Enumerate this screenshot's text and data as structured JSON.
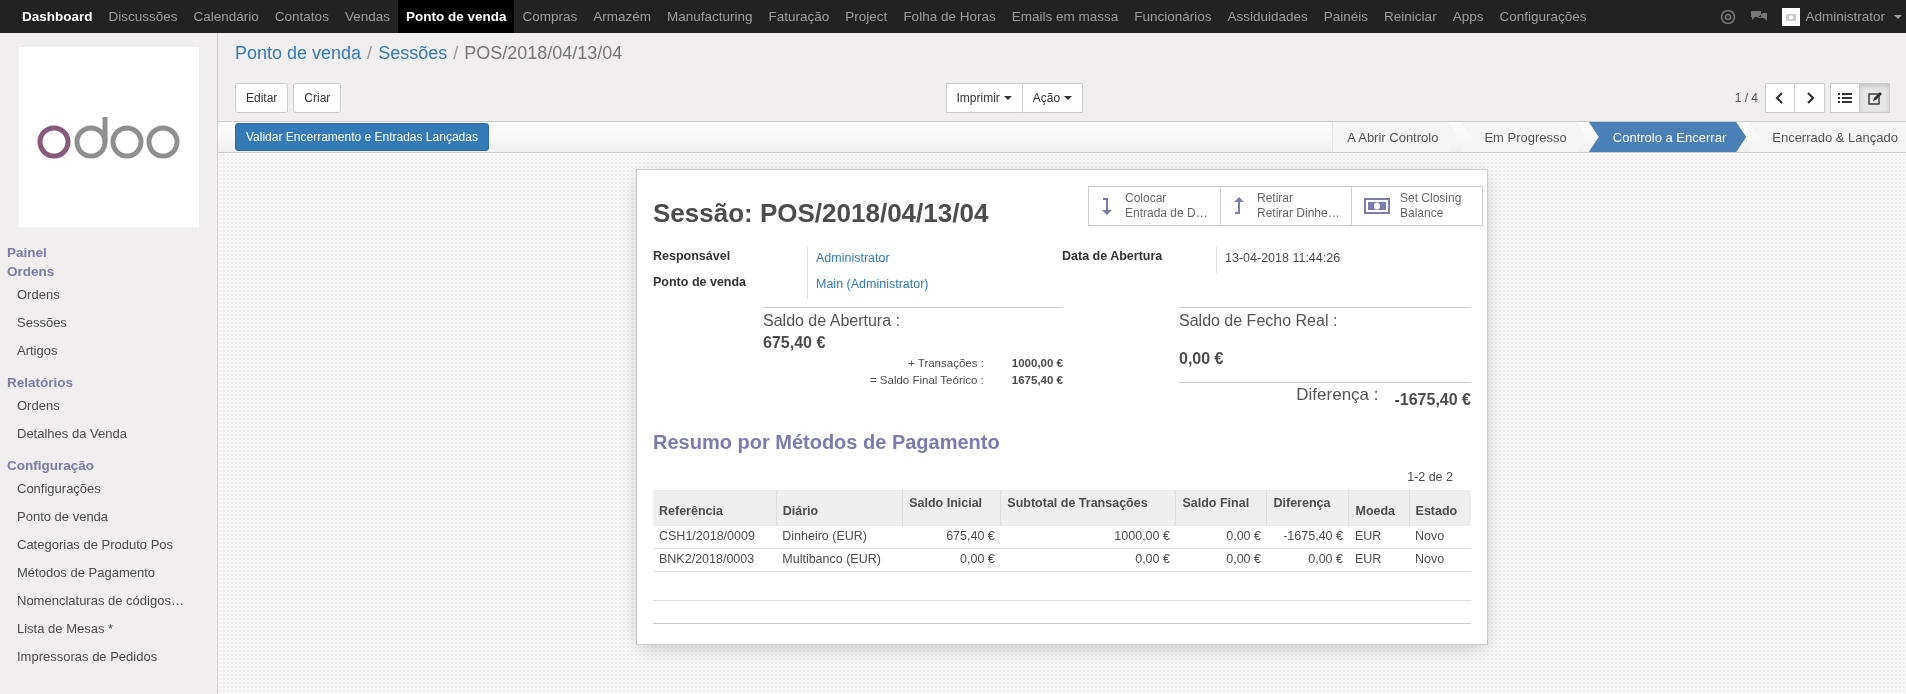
{
  "top_menu": {
    "app_name": "Dashboard",
    "items": [
      {
        "label": "Discussões",
        "selected": false
      },
      {
        "label": "Calendário",
        "selected": false
      },
      {
        "label": "Contatos",
        "selected": false
      },
      {
        "label": "Vendas",
        "selected": false
      },
      {
        "label": "Ponto de venda",
        "selected": true
      },
      {
        "label": "Compras",
        "selected": false
      },
      {
        "label": "Armazém",
        "selected": false
      },
      {
        "label": "Manufacturing",
        "selected": false
      },
      {
        "label": "Faturação",
        "selected": false
      },
      {
        "label": "Project",
        "selected": false
      },
      {
        "label": "Folha de Horas",
        "selected": false
      },
      {
        "label": "Emails em massa",
        "selected": false
      },
      {
        "label": "Funcionários",
        "selected": false
      },
      {
        "label": "Assiduidades",
        "selected": false
      },
      {
        "label": "Painéis",
        "selected": false
      },
      {
        "label": "Reiniciar",
        "selected": false
      },
      {
        "label": "Apps",
        "selected": false
      },
      {
        "label": "Configurações",
        "selected": false
      }
    ],
    "user": "Administrator"
  },
  "sidebar": {
    "sections": [
      {
        "title": "Painel"
      },
      {
        "title": "Ordens",
        "items": [
          "Ordens",
          "Sessões",
          "Artigos"
        ]
      },
      {
        "title": "Relatórios",
        "items": [
          "Ordens",
          "Detalhes da Venda"
        ]
      },
      {
        "title": "Configuração",
        "items": [
          "Configurações",
          "Ponto de venda",
          "Categorias de Produto Pos",
          "Métodos de Pagamento",
          "Nomenclaturas de códigos…",
          "Lista de Mesas *",
          "Impressoras de Pedidos"
        ]
      }
    ]
  },
  "breadcrumb_separator": "/",
  "breadcrumb": [
    {
      "label": "Ponto de venda",
      "link": true
    },
    {
      "label": "Sessões",
      "link": true
    },
    {
      "label": "POS/2018/04/13/04",
      "link": false
    }
  ],
  "buttons": [
    "Editar",
    "Criar"
  ],
  "dropdowns": [
    "Imprimir",
    "Ação"
  ],
  "pager": "1 / 4",
  "views": [
    {
      "kind": "list",
      "selected": false
    },
    {
      "kind": "form",
      "selected": true
    }
  ],
  "action_button": "Validar Encerramento e Entradas Lançadas",
  "stages": [
    {
      "label": "A Abrir Controlo",
      "selected": false
    },
    {
      "label": "Em Progresso",
      "selected": false
    },
    {
      "label": "Controlo a Encerrar",
      "selected": true
    },
    {
      "label": "Encerrado & Lançado",
      "selected": false
    }
  ],
  "form": {
    "title": "Sessão: POS/2018/04/13/04",
    "smart_buttons": [
      {
        "kind": "deposit",
        "lines": [
          "Colocar",
          "Entrada de D…"
        ]
      },
      {
        "kind": "withdraw",
        "lines": [
          "Retirar",
          "Retirar Dinhe…"
        ]
      },
      {
        "kind": "balance",
        "lines": [
          "Set Closing",
          "Balance"
        ]
      }
    ],
    "fields_left": [
      {
        "label": "Responsável",
        "value": "Administrator",
        "link": true
      },
      {
        "label": "Ponto de venda",
        "value": "Main (Administrator)",
        "link": true
      }
    ],
    "fields_right": [
      {
        "label": "Data de Abertura",
        "value": "13-04-2018 11:44:26",
        "link": false
      }
    ],
    "balance_left": [
      {
        "label": "Saldo de Abertura :",
        "value": "675,40 €",
        "kind": "main"
      },
      {
        "label": "+ Transações :",
        "value": "1000,00 €",
        "kind": "sub"
      },
      {
        "label": "= Saldo Final Teórico :",
        "value": "1675,40 €",
        "kind": "sub"
      }
    ],
    "balance_right": [
      {
        "label": "Saldo de Fecho Real :",
        "value": "0,00 €",
        "kind": "main"
      },
      {
        "label": "Diferença :",
        "value": "-1675,40 €",
        "kind": "total"
      }
    ],
    "section_title": "Resumo por Métodos de Pagamento",
    "table": {
      "pager": "1-2 de 2",
      "columns": [
        {
          "label": "Referência",
          "numeric": false
        },
        {
          "label": "Diário",
          "numeric": false
        },
        {
          "label": "Saldo Inicial",
          "numeric": true
        },
        {
          "label": "Subtotal de Transações",
          "numeric": true
        },
        {
          "label": "Saldo Final",
          "numeric": true
        },
        {
          "label": "Diferença",
          "numeric": true
        },
        {
          "label": "Moeda",
          "numeric": false
        },
        {
          "label": "Estado",
          "numeric": false
        }
      ],
      "rows": [
        [
          "CSH1/2018/0009",
          "Dinheiro (EUR)",
          "675,40 €",
          "1000,00 €",
          "0,00 €",
          "-1675,40 €",
          "EUR",
          "Novo"
        ],
        [
          "BNK2/2018/0003",
          "Multibanco (EUR)",
          "0,00 €",
          "0,00 €",
          "0,00 €",
          "0,00 €",
          "EUR",
          "Novo"
        ]
      ]
    }
  }
}
